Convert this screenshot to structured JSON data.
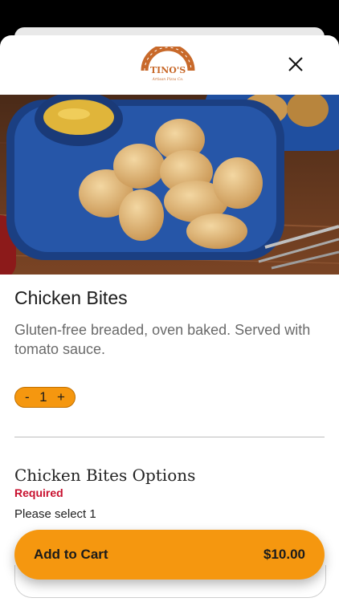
{
  "header": {
    "logo_text": "TINO'S",
    "logo_tagline": "Artisan Pizza Co.",
    "close_icon": "close-icon"
  },
  "item": {
    "name": "Chicken Bites",
    "description": "Gluten-free breaded, oven baked. Served with tomato sauce."
  },
  "quantity": {
    "decrement_label": "-",
    "value": "1",
    "increment_label": "+"
  },
  "options": {
    "title": "Chicken Bites Options",
    "required_label": "Required",
    "instruction": "Please select 1"
  },
  "cart": {
    "button_label": "Add to Cart",
    "price": "$10.00"
  },
  "colors": {
    "accent": "#f5970f",
    "required": "#c8102e",
    "plate": "#1f4fa0"
  }
}
